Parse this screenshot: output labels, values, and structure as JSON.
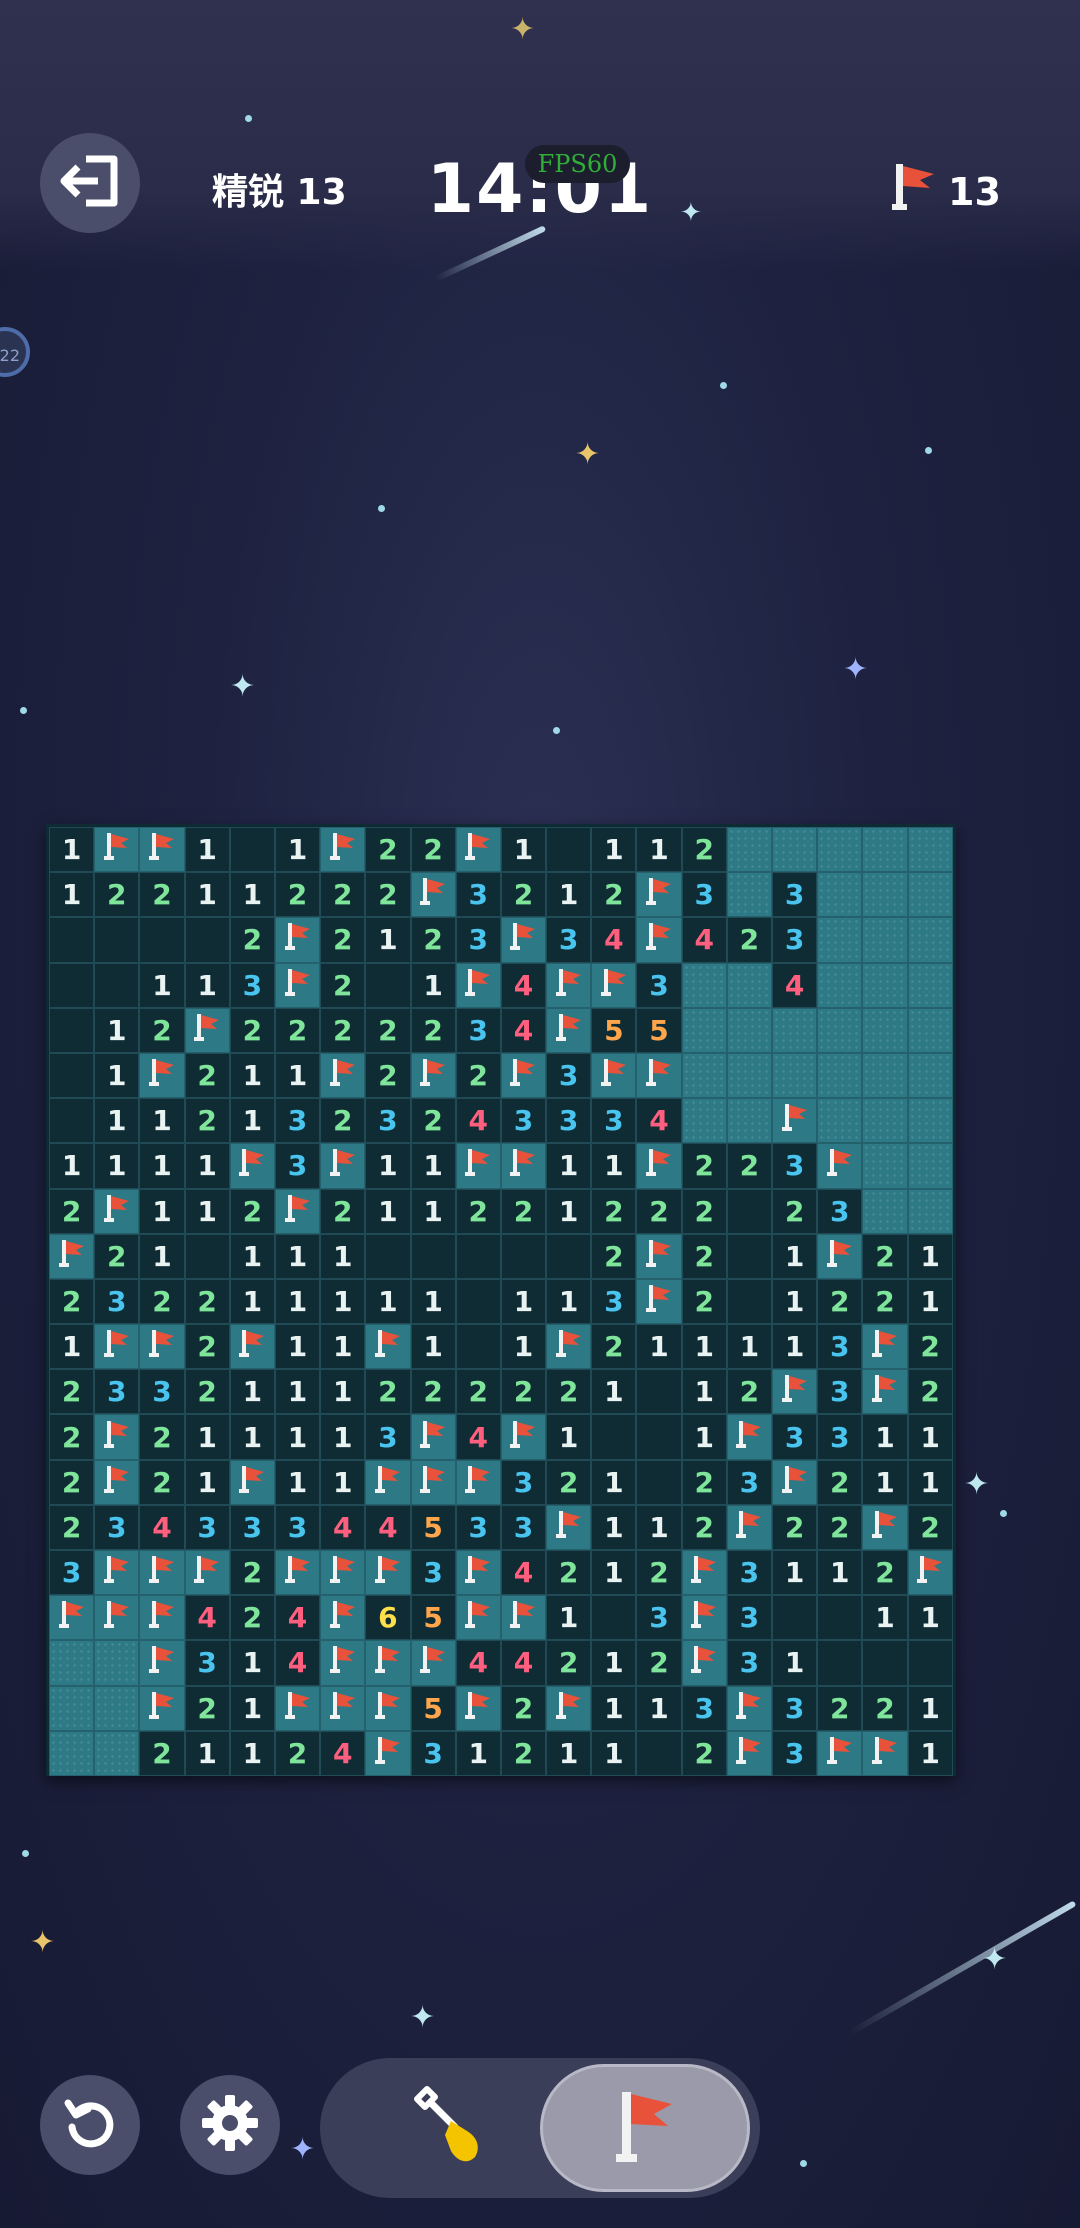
{
  "header": {
    "level": "精锐 13",
    "timer": "14:01",
    "fps": "FPS60",
    "flags_remaining": "13",
    "side_badge": "22"
  },
  "icons": {
    "exit": "exit-icon",
    "restart": "restart-icon",
    "settings": "gear-icon",
    "dig": "shovel-icon",
    "flag": "flag-icon"
  },
  "colors": {
    "hidden_cell": "#2d7a86",
    "revealed_cell": "#0f2b33",
    "flag": "#e8523a",
    "num1": "#e9f3f2",
    "num2": "#7fe59a",
    "num3": "#49c4ee",
    "num4": "#ff5f7e",
    "num5": "#ffa64d",
    "num6": "#ffe04a"
  },
  "board": {
    "columns": 20,
    "rows": 21,
    "legend": "H = hidden, F = flagged, 0 = empty revealed, digit = adjacent mine count",
    "cells": [
      [
        "1",
        "F",
        "F",
        "1",
        "0",
        "1",
        "F",
        "2",
        "2",
        "F",
        "1",
        "0",
        "1",
        "1",
        "2",
        "H",
        "H",
        "H",
        "H",
        "H"
      ],
      [
        "1",
        "2",
        "2",
        "1",
        "1",
        "2",
        "2",
        "2",
        "F",
        "3",
        "2",
        "1",
        "2",
        "F",
        "3",
        "H",
        "3",
        "H",
        "H",
        "H"
      ],
      [
        "0",
        "0",
        "0",
        "0",
        "2",
        "F",
        "2",
        "1",
        "2",
        "3",
        "F",
        "3",
        "4",
        "F",
        "4",
        "2",
        "3",
        "H",
        "H",
        "H"
      ],
      [
        "0",
        "0",
        "1",
        "1",
        "3",
        "F",
        "2",
        "0",
        "1",
        "F",
        "4",
        "F",
        "F",
        "3",
        "H",
        "H",
        "4",
        "H",
        "H",
        "H"
      ],
      [
        "0",
        "1",
        "2",
        "F",
        "2",
        "2",
        "2",
        "2",
        "2",
        "3",
        "4",
        "F",
        "5",
        "5",
        "H",
        "H",
        "H",
        "H",
        "H",
        "H"
      ],
      [
        "0",
        "1",
        "F",
        "2",
        "1",
        "1",
        "F",
        "2",
        "F",
        "2",
        "F",
        "3",
        "F",
        "F",
        "H",
        "H",
        "H",
        "H",
        "H",
        "H"
      ],
      [
        "0",
        "1",
        "1",
        "2",
        "1",
        "3",
        "2",
        "3",
        "2",
        "4",
        "3",
        "3",
        "3",
        "4",
        "H",
        "H",
        "F",
        "H",
        "H",
        "H"
      ],
      [
        "1",
        "1",
        "1",
        "1",
        "F",
        "3",
        "F",
        "1",
        "1",
        "F",
        "F",
        "1",
        "1",
        "F",
        "2",
        "2",
        "3",
        "F",
        "H",
        "H"
      ],
      [
        "2",
        "F",
        "1",
        "1",
        "2",
        "F",
        "2",
        "1",
        "1",
        "2",
        "2",
        "1",
        "2",
        "2",
        "2",
        "0",
        "2",
        "3",
        "H",
        "H"
      ],
      [
        "F",
        "2",
        "1",
        "0",
        "1",
        "1",
        "1",
        "0",
        "0",
        "0",
        "0",
        "0",
        "2",
        "F",
        "2",
        "0",
        "1",
        "F",
        "2",
        "1"
      ],
      [
        "2",
        "3",
        "2",
        "2",
        "1",
        "1",
        "1",
        "1",
        "1",
        "0",
        "1",
        "1",
        "3",
        "F",
        "2",
        "0",
        "1",
        "2",
        "2",
        "1"
      ],
      [
        "1",
        "F",
        "F",
        "2",
        "F",
        "1",
        "1",
        "F",
        "1",
        "0",
        "1",
        "F",
        "2",
        "1",
        "1",
        "1",
        "1",
        "3",
        "F",
        "2"
      ],
      [
        "2",
        "3",
        "3",
        "2",
        "1",
        "1",
        "1",
        "2",
        "2",
        "2",
        "2",
        "2",
        "1",
        "0",
        "1",
        "2",
        "F",
        "3",
        "F",
        "2"
      ],
      [
        "2",
        "F",
        "2",
        "1",
        "1",
        "1",
        "1",
        "3",
        "F",
        "4",
        "F",
        "1",
        "0",
        "0",
        "1",
        "F",
        "3",
        "3",
        "1",
        "1"
      ],
      [
        "2",
        "F",
        "2",
        "1",
        "F",
        "1",
        "1",
        "F",
        "F",
        "F",
        "3",
        "2",
        "1",
        "0",
        "2",
        "3",
        "F",
        "2",
        "1",
        "1"
      ],
      [
        "2",
        "3",
        "4",
        "3",
        "3",
        "3",
        "4",
        "4",
        "5",
        "3",
        "3",
        "F",
        "1",
        "1",
        "2",
        "F",
        "2",
        "2",
        "F",
        "2"
      ],
      [
        "3",
        "F",
        "F",
        "F",
        "2",
        "F",
        "F",
        "F",
        "3",
        "F",
        "4",
        "2",
        "1",
        "2",
        "F",
        "3",
        "1",
        "1",
        "2",
        "F"
      ],
      [
        "F",
        "F",
        "F",
        "4",
        "2",
        "4",
        "F",
        "6",
        "5",
        "F",
        "F",
        "1",
        "0",
        "3",
        "F",
        "3",
        "0",
        "0",
        "1",
        "1"
      ],
      [
        "H",
        "H",
        "F",
        "3",
        "1",
        "4",
        "F",
        "F",
        "F",
        "4",
        "4",
        "2",
        "1",
        "2",
        "F",
        "3",
        "1",
        "0",
        "0",
        "0"
      ],
      [
        "H",
        "H",
        "F",
        "2",
        "1",
        "F",
        "F",
        "F",
        "5",
        "F",
        "2",
        "F",
        "1",
        "1",
        "3",
        "F",
        "3",
        "2",
        "2",
        "1"
      ],
      [
        "H",
        "H",
        "2",
        "1",
        "1",
        "2",
        "4",
        "F",
        "3",
        "1",
        "2",
        "1",
        "1",
        "0",
        "2",
        "F",
        "3",
        "F",
        "F",
        "1"
      ]
    ]
  }
}
